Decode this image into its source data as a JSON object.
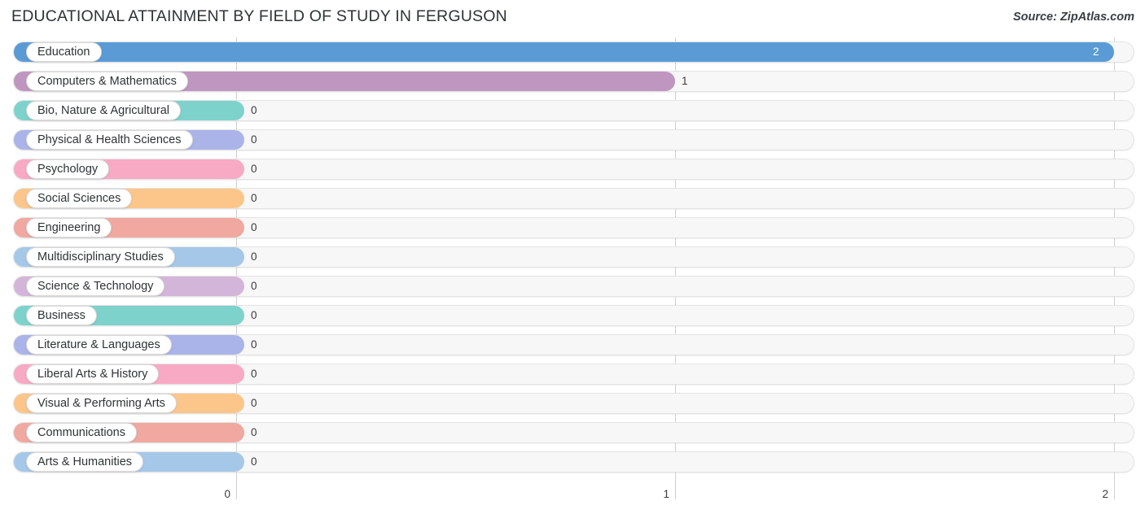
{
  "header": {
    "title": "EDUCATIONAL ATTAINMENT BY FIELD OF STUDY IN FERGUSON",
    "source": "Source: ZipAtlas.com"
  },
  "chart_data": {
    "type": "bar",
    "orientation": "horizontal",
    "title": "EDUCATIONAL ATTAINMENT BY FIELD OF STUDY IN FERGUSON",
    "xlabel": "",
    "ylabel": "",
    "xlim": [
      0,
      2
    ],
    "xticks": [
      "0",
      "1",
      "2"
    ],
    "xtick_values": [
      0,
      1,
      2
    ],
    "grid": true,
    "legend": false,
    "categories": [
      "Education",
      "Computers & Mathematics",
      "Bio, Nature & Agricultural",
      "Physical & Health Sciences",
      "Psychology",
      "Social Sciences",
      "Engineering",
      "Multidisciplinary Studies",
      "Science & Technology",
      "Business",
      "Literature & Languages",
      "Liberal Arts & History",
      "Visual & Performing Arts",
      "Communications",
      "Arts & Humanities"
    ],
    "values": [
      2,
      1,
      0,
      0,
      0,
      0,
      0,
      0,
      0,
      0,
      0,
      0,
      0,
      0,
      0
    ],
    "value_labels": [
      "2",
      "1",
      "0",
      "0",
      "0",
      "0",
      "0",
      "0",
      "0",
      "0",
      "0",
      "0",
      "0",
      "0",
      "0"
    ],
    "colors": [
      "#5b9bd5",
      "#bf96c0",
      "#7dd3cc",
      "#aab4e8",
      "#f8a9c4",
      "#fcc68a",
      "#f0a8a0",
      "#a6c8e8",
      "#d4b5da",
      "#7dd3cc",
      "#aab4e8",
      "#f8a9c4",
      "#fcc68a",
      "#f0a8a0",
      "#a6c8e8"
    ]
  },
  "style": {
    "track_color": "#f7f7f7",
    "track_border": "#e3e3e3",
    "gridline_color": "#d0d0d0",
    "pill_background": "#ffffff",
    "text_color": "#2f3336"
  }
}
